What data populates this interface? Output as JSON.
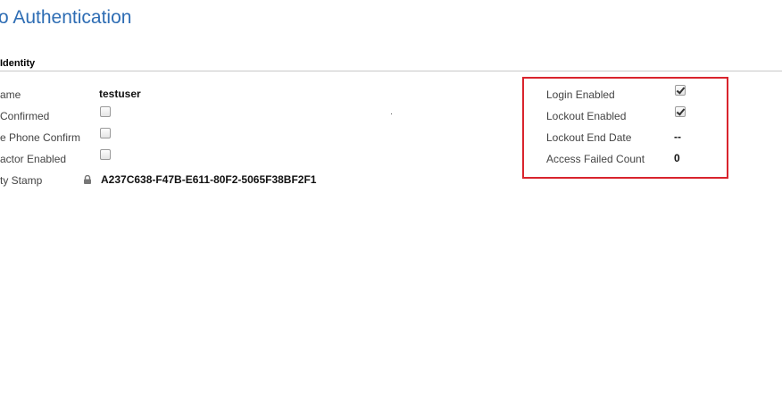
{
  "page": {
    "title": "o Authentication"
  },
  "section": {
    "header": "Identity"
  },
  "left_fields": {
    "username_label": "ame",
    "username_value": "testuser",
    "email_confirmed_label": "Confirmed",
    "phone_confirmed_label": "e Phone Confirm",
    "two_factor_label": "actor Enabled",
    "security_stamp_label": "ty Stamp",
    "security_stamp_value": "A237C638-F47B-E611-80F2-5065F38BF2F1",
    "email_confirmed": false,
    "phone_confirmed": false,
    "two_factor_enabled": false
  },
  "right_fields": {
    "login_enabled_label": "Login Enabled",
    "lockout_enabled_label": "Lockout Enabled",
    "lockout_end_date_label": "Lockout End Date",
    "lockout_end_date_value": "--",
    "access_failed_count_label": "Access Failed Count",
    "access_failed_count_value": "0",
    "login_enabled": true,
    "lockout_enabled": true
  },
  "colors": {
    "title": "#2e6db4",
    "highlight_border": "#d9242d"
  },
  "icons": {
    "security_stamp": "lock-icon"
  }
}
